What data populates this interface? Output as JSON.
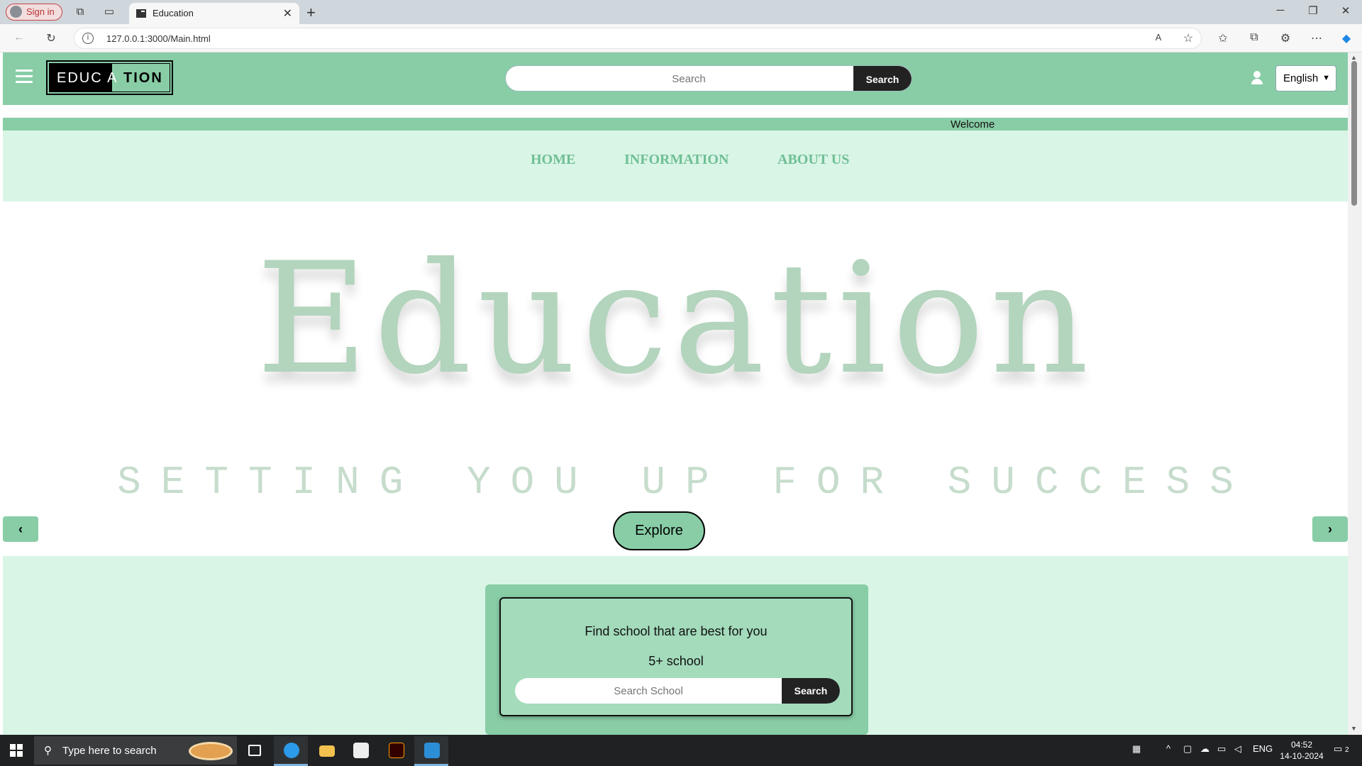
{
  "browser": {
    "signin_label": "Sign in",
    "tab_title": "Education",
    "url": "127.0.0.1:3000/Main.html"
  },
  "header": {
    "logo_text_white": "EDUC A",
    "logo_text_black": " TION",
    "search_placeholder": "Search",
    "search_button": "Search",
    "language": "English"
  },
  "welcome_text": "Welcome",
  "nav": {
    "items": [
      {
        "label": "HOME"
      },
      {
        "label": "INFORMATION"
      },
      {
        "label": "ABOUT US"
      }
    ]
  },
  "hero": {
    "title": "Education",
    "subtitle": "SETTING YOU UP FOR SUCCESS",
    "explore_button": "Explore",
    "prev_icon": "chevron-left",
    "next_icon": "chevron-right"
  },
  "finder": {
    "heading": "Find school that are best for you",
    "count": "5+ school",
    "search_placeholder": "Search School",
    "search_button": "Search"
  },
  "taskbar": {
    "search_placeholder": "Type here to search",
    "language": "ENG",
    "time": "04:52",
    "date": "14-10-2024",
    "notifications": "2"
  },
  "colors": {
    "brand": "#88cda6",
    "light_bg": "#d9f5e6",
    "nav_text": "#6fbf95",
    "hero_title": "#b3d4bd"
  }
}
